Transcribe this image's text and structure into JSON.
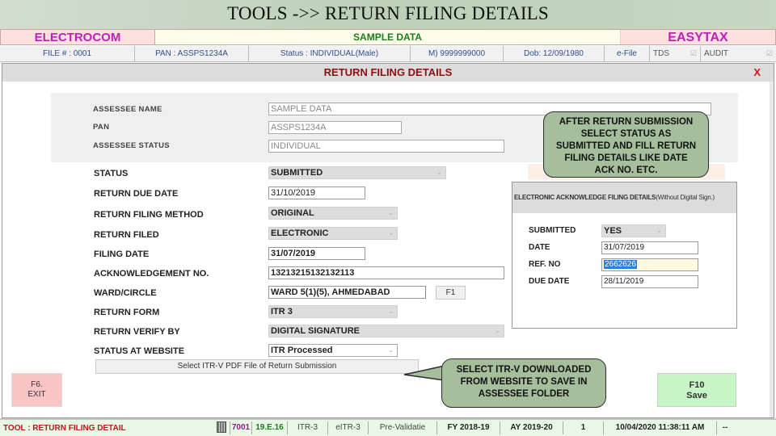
{
  "slide_title": "TOOLS ->> RETURN FILING DETAILS",
  "brand": {
    "left": "ELECTROCOM",
    "center": "SAMPLE DATA",
    "right": "EASYTAX"
  },
  "infobar": {
    "file": "FILE # : 0001",
    "pan": "PAN : ASSPS1234A",
    "status": "Status : INDIVIDUAL(Male)",
    "mobile": "M) 9999999000",
    "dob": "Dob: 12/09/1980",
    "efile": "e-File",
    "tds": "TDS",
    "audit": "AUDIT"
  },
  "dialog": {
    "title": "RETURN FILING DETAILS",
    "close": "X",
    "assessee": {
      "name_label": "ASSESSEE NAME",
      "name_value": "SAMPLE DATA",
      "pan_label": "PAN",
      "pan_value": "ASSPS1234A",
      "status_label": "ASSESSEE STATUS",
      "status_value": "INDIVIDUAL"
    },
    "fields": {
      "status": {
        "label": "STATUS",
        "value": "SUBMITTED"
      },
      "due_date": {
        "label": "RETURN DUE DATE",
        "value": "31/10/2019"
      },
      "filing_method": {
        "label": "RETURN FILING METHOD",
        "value": "ORIGINAL"
      },
      "return_filed": {
        "label": "RETURN FILED",
        "value": "ELECTRONIC"
      },
      "filing_date": {
        "label": "FILING DATE",
        "value": "31/07/2019"
      },
      "ack_no": {
        "label": "ACKNOWLEDGEMENT NO.",
        "value": "13213215132132113"
      },
      "ward": {
        "label": "WARD/CIRCLE",
        "value": "WARD  5(1)(5), AHMEDABAD",
        "button": "F1"
      },
      "return_form": {
        "label": "RETURN FORM",
        "value": "ITR 3"
      },
      "verify_by": {
        "label": "RETURN VERIFY BY",
        "value": "DIGITAL SIGNATURE"
      },
      "website_status": {
        "label": "STATUS AT WEBSITE",
        "value": "ITR Processed"
      }
    },
    "select_pdf_button": "Select ITR-V PDF File of Return Submission",
    "ack_panel": {
      "title_bold": "ELECTRONIC ACKNOWLEDGE FILING DETAILS",
      "title_normal": "(Without Digital Sign.)",
      "submitted": {
        "label": "SUBMITTED",
        "value": "YES"
      },
      "date": {
        "label": "DATE",
        "value": "31/07/2019"
      },
      "ref_no": {
        "label": "REF. NO",
        "value": "2662626"
      },
      "due_date": {
        "label": "DUE DATE",
        "value": "28/11/2019"
      }
    },
    "exit_button": {
      "key": "F6.",
      "label": "EXIT"
    },
    "save_button": {
      "key": "F10",
      "label": "Save"
    }
  },
  "callouts": {
    "top": [
      "AFTER RETURN SUBMISSION",
      "SELECT STATUS AS",
      "SUBMITTED AND FILL RETURN",
      "FILING DETAILS LIKE DATE",
      "ACK NO. ETC."
    ],
    "bottom": [
      "SELECT ITR-V DOWNLOADED",
      "FROM WEBSITE TO SAVE IN",
      "ASSESSEE FOLDER"
    ]
  },
  "statusbar": {
    "tool": "TOOL : RETURN FILING DETAIL",
    "code": "7001",
    "version": "19.E.16",
    "itr": "ITR-3",
    "eitr": "eITR-3",
    "prevalidate": "Pre-Validatie",
    "fy": "FY 2018-19",
    "ay": "AY 2019-20",
    "count": "1",
    "datetime": "10/04/2020 11:38:11 AM",
    "extra": "--"
  },
  "colors": {
    "brand_magenta": "#c020b8",
    "brand_green": "#1b7d1b",
    "dialog_title": "#8e0f12",
    "callout_fill": "#a5bf9d",
    "exit_bg": "#f8c4c4",
    "save_bg": "#c8f5c6"
  }
}
